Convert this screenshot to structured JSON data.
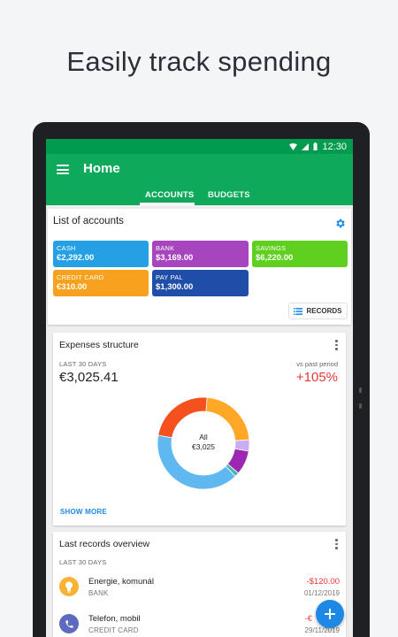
{
  "headline": "Easily track spending",
  "status": {
    "time": "12:30"
  },
  "appbar": {
    "title": "Home",
    "tabs": [
      {
        "label": "ACCOUNTS",
        "active": true
      },
      {
        "label": "BUDGETS",
        "active": false
      }
    ]
  },
  "accounts": {
    "title": "List of accounts",
    "items": [
      {
        "label": "CASH",
        "value": "€2,292.00",
        "color": "#26a0e5"
      },
      {
        "label": "BANK",
        "value": "$3,169.00",
        "color": "#a645bd"
      },
      {
        "label": "SAVINGS",
        "value": "$6,220.00",
        "color": "#5fd01f"
      },
      {
        "label": "CREDIT CARD",
        "value": "€310.00",
        "color": "#f8a11f"
      },
      {
        "label": "PAY PAL",
        "value": "$1,300.00",
        "color": "#1e4ea8"
      }
    ],
    "records_button": "RECORDS"
  },
  "expenses": {
    "title": "Expenses structure",
    "period": "LAST 30 DAYS",
    "amount": "€3,025.41",
    "vs_label": "vs past period",
    "change": "+105%",
    "donut_label": "All",
    "donut_total": "€3,025",
    "segments": [
      {
        "share": 0.225,
        "color": "#ffa726"
      },
      {
        "share": 0.04,
        "color": "#c8aef0"
      },
      {
        "share": 0.085,
        "color": "#9c27b0"
      },
      {
        "share": 0.015,
        "color": "#4db6ac"
      },
      {
        "share": 0.4,
        "color": "#5fb8f0"
      },
      {
        "share": 0.235,
        "color": "#f4511e"
      }
    ],
    "show_more": "SHOW MORE"
  },
  "records": {
    "title": "Last records overview",
    "period": "LAST 30 DAYS",
    "items": [
      {
        "name": "Energie, komunál",
        "account": "BANK",
        "amount": "-$120.00",
        "date": "01/12/2019",
        "icon": "lightbulb-icon",
        "color": "#f9b233"
      },
      {
        "name": "Telefon, mobil",
        "account": "CREDIT CARD",
        "amount": "-€",
        "date": "29/11/2019",
        "icon": "phone-icon",
        "color": "#5c6bc0"
      }
    ]
  },
  "fab": {
    "icon": "plus-icon"
  }
}
